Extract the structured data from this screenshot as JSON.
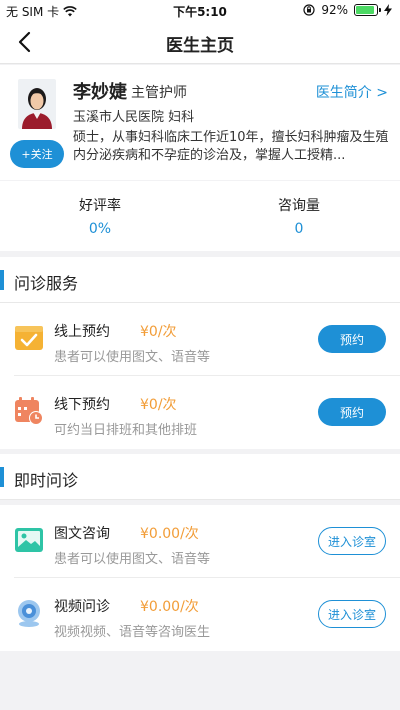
{
  "status_bar": {
    "carrier": "无 SIM 卡",
    "time": "下午5:10",
    "battery": "92%",
    "battery_level": 0.92
  },
  "nav": {
    "title": "医生主页",
    "back_icon": "chevron-left-icon"
  },
  "doctor": {
    "name": "李妙婕",
    "title": "主管护师",
    "hospital": "玉溪市人民医院  妇科",
    "bio": "硕士，从事妇科临床工作近10年，擅长妇科肿瘤及生殖内分泌疾病和不孕症的诊治及，掌握人工授精...",
    "intro_link": "医生简介 >",
    "follow_label": "+关注"
  },
  "stats": {
    "rating_label": "好评率",
    "rating_value": "0%",
    "consult_label": "咨询量",
    "consult_value": "0"
  },
  "sections": {
    "appointment": {
      "header": "问诊服务",
      "items": [
        {
          "name": "线上预约",
          "price": "¥0/次",
          "desc": "患者可以使用图文、语音等",
          "button": "预约",
          "icon": "online-appointment-icon"
        },
        {
          "name": "线下预约",
          "price": "¥0/次",
          "desc": "可约当日排班和其他排班",
          "button": "预约",
          "icon": "calendar-clock-icon"
        }
      ]
    },
    "instant": {
      "header": "即时问诊",
      "items": [
        {
          "name": "图文咨询",
          "price": "¥0.00/次",
          "desc": "患者可以使用图文、语音等",
          "button": "进入诊室",
          "icon": "image-consult-icon"
        },
        {
          "name": "视频问诊",
          "price": "¥0.00/次",
          "desc": "视频视频、语音等咨询医生",
          "button": "进入诊室",
          "icon": "video-camera-icon"
        }
      ]
    }
  },
  "colors": {
    "accent": "#1e90d6",
    "price": "#f29d38",
    "muted": "#999999"
  }
}
